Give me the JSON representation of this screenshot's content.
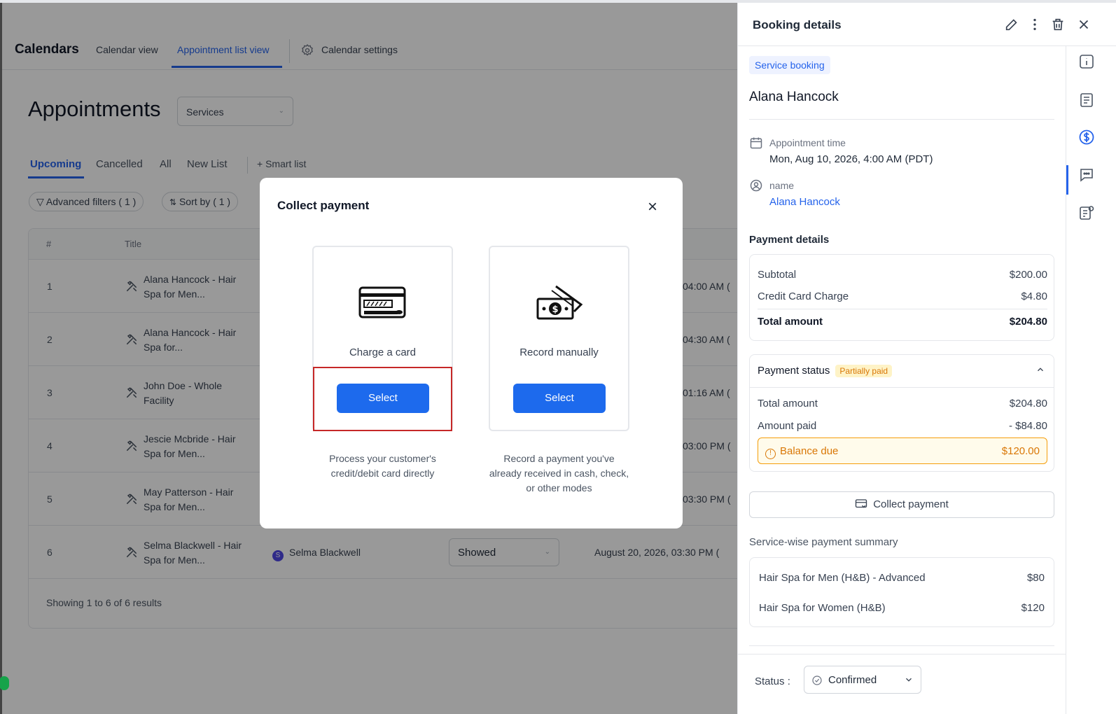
{
  "nav": {
    "brand": "Calendars",
    "tabs": [
      "Calendar view",
      "Appointment list view",
      "Calendar settings"
    ]
  },
  "page": {
    "title": "Appointments",
    "services_select": "Services",
    "subtabs": [
      "Upcoming",
      "Cancelled",
      "All",
      "New List",
      "+ Smart list"
    ],
    "filters": {
      "advanced": "Advanced filters ( 1 )",
      "sort": "Sort by ( 1 )"
    }
  },
  "table": {
    "headers": [
      "#",
      "Title"
    ],
    "rows": [
      {
        "num": "1",
        "title": "Alana Hancock - Hair Spa for Men...",
        "time": "04:00 AM ("
      },
      {
        "num": "2",
        "title": "Alana Hancock - Hair Spa for...",
        "time": "04:30 AM ("
      },
      {
        "num": "3",
        "title": "John Doe - Whole Facility",
        "time": "01:16 AM ("
      },
      {
        "num": "4",
        "title": "Jescie Mcbride - Hair Spa for Men...",
        "time": "03:00 PM ("
      },
      {
        "num": "5",
        "title": "May Patterson - Hair Spa for Men...",
        "time": "03:30 PM ("
      },
      {
        "num": "6",
        "title": "Selma Blackwell - Hair Spa for Men...",
        "contact": "Selma Blackwell",
        "contact_initial": "S",
        "status": "Showed",
        "time": "August 20, 2026, 03:30 PM ("
      }
    ],
    "footer": "Showing 1 to 6 of 6 results"
  },
  "modal": {
    "title": "Collect payment",
    "options": [
      {
        "label": "Charge a card",
        "button": "Select",
        "description": "Process your customer's credit/debit card directly",
        "icon": "credit-card-icon"
      },
      {
        "label": "Record manually",
        "button": "Select",
        "description": "Record a payment you've already received in cash, check, or other modes",
        "icon": "cash-icon"
      }
    ]
  },
  "panel": {
    "title": "Booking details",
    "tag": "Service booking",
    "client_name": "Alana Hancock",
    "appointment_time_label": "Appointment time",
    "appointment_time": "Mon, Aug 10, 2026, 4:00 AM (PDT)",
    "name_label": "name",
    "name_value": "Alana Hancock",
    "payment_details": {
      "title": "Payment details",
      "subtotal_label": "Subtotal",
      "subtotal": "$200.00",
      "cc_label": "Credit Card Charge",
      "cc": "$4.80",
      "total_label": "Total amount",
      "total": "$204.80"
    },
    "payment_status": {
      "title": "Payment status",
      "badge": "Partially paid",
      "total_label": "Total amount",
      "total": "$204.80",
      "paid_label": "Amount paid",
      "paid": "- $84.80",
      "balance_label": "Balance due",
      "balance": "$120.00"
    },
    "collect_button": "Collect payment",
    "service_summary": {
      "title": "Service-wise payment summary",
      "items": [
        {
          "name": "Hair Spa for Men (H&B) - Advanced",
          "amount": "$80"
        },
        {
          "name": "Hair Spa for Women (H&B)",
          "amount": "$120"
        }
      ]
    },
    "status_label": "Status :",
    "status_value": "Confirmed"
  },
  "colors": {
    "accent": "#2563eb",
    "button": "#1d6aed",
    "warning": "#d97706",
    "highlight": "#c62828"
  }
}
